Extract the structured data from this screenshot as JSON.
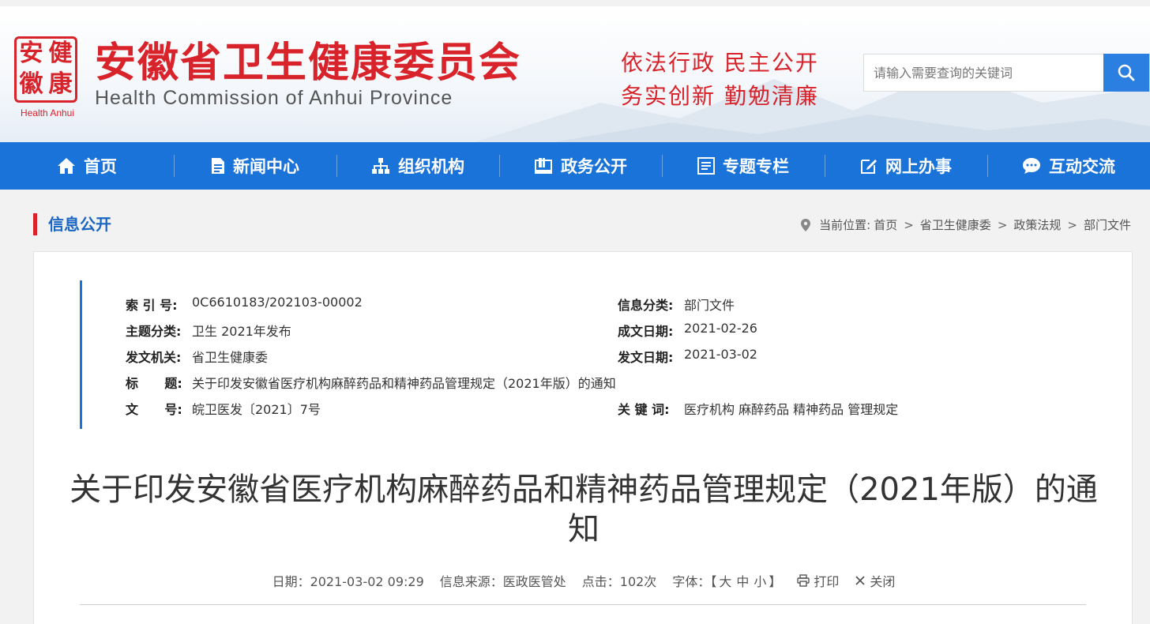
{
  "header": {
    "logo_chars": [
      "安",
      "健",
      "徽",
      "康"
    ],
    "logo_en": "Health Anhui",
    "site_title": "安徽省卫生健康委员会",
    "site_subtitle": "Health Commission of Anhui Province",
    "motto_line1": "依法行政  民主公开",
    "motto_line2": "务实创新  勤勉清廉",
    "search_placeholder": "请输入需要查询的关键词"
  },
  "nav": [
    {
      "label": "首页",
      "icon": "home-icon"
    },
    {
      "label": "新闻中心",
      "icon": "document-icon"
    },
    {
      "label": "组织机构",
      "icon": "org-chart-icon"
    },
    {
      "label": "政务公开",
      "icon": "folder-icon"
    },
    {
      "label": "专题专栏",
      "icon": "list-icon"
    },
    {
      "label": "网上办事",
      "icon": "edit-icon"
    },
    {
      "label": "互动交流",
      "icon": "chat-icon"
    }
  ],
  "section": {
    "title": "信息公开",
    "breadcrumb_prefix": "当前位置:",
    "breadcrumb": [
      "首页",
      "省卫生健康委",
      "政策法规",
      "部门文件"
    ]
  },
  "meta": {
    "index_label": "索 引 号:",
    "index_value": "0C6610183/202103-00002",
    "category_label": "信息分类:",
    "category_value": "部门文件",
    "topic_label": "主题分类:",
    "topic_value": "卫生 2021年发布",
    "created_label": "成文日期:",
    "created_value": "2021-02-26",
    "issuer_label": "发文机关:",
    "issuer_value": "省卫生健康委",
    "issued_label": "发文日期:",
    "issued_value": "2021-03-02",
    "title_label": "标      题:",
    "title_value": "关于印发安徽省医疗机构麻醉药品和精神药品管理规定（2021年版）的通知",
    "docno_label": "文      号:",
    "docno_value": "皖卫医发〔2021〕7号",
    "keywords_label": "关 键 词:",
    "keywords_value": "医疗机构 麻醉药品 精神药品 管理规定"
  },
  "article": {
    "title": "关于印发安徽省医疗机构麻醉药品和精神药品管理规定（2021年版）的通知",
    "date": "日期：2021-03-02 09:29",
    "source": "信息来源：医政医管处",
    "clicks": "点击：102次",
    "font_label": "字体：【",
    "font_large": "大",
    "font_medium": "中",
    "font_small": "小",
    "font_close": "】",
    "print": "打印",
    "close": "关闭"
  },
  "colors": {
    "brand_red": "#d9232b",
    "nav_blue": "#1a73d9",
    "link_blue": "#1a66c2"
  }
}
